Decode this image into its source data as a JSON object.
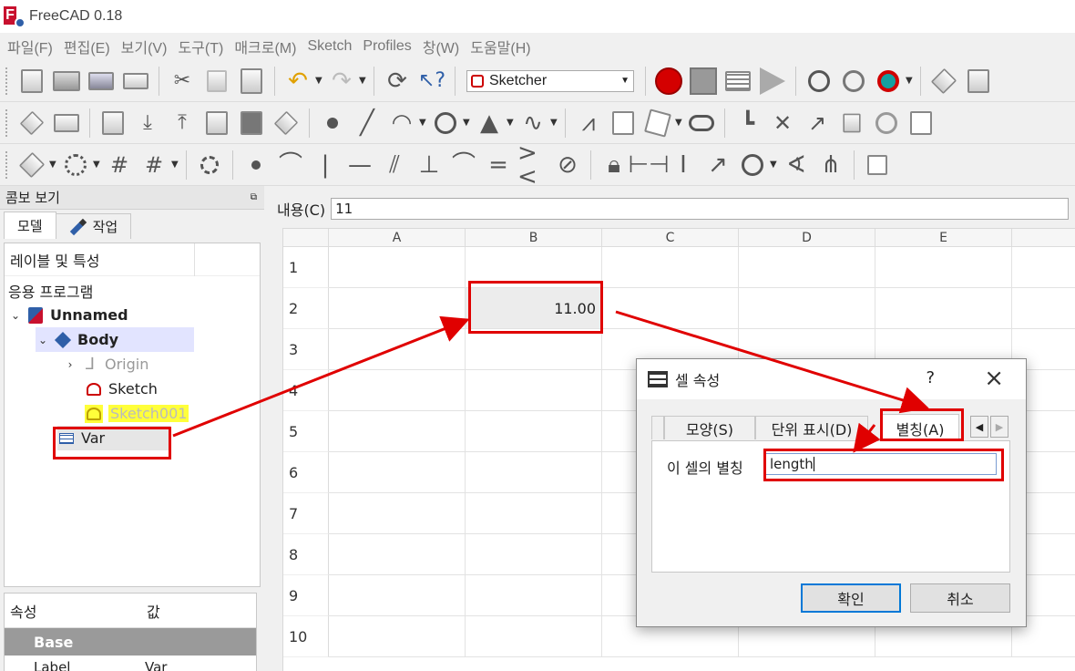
{
  "window": {
    "title": "FreeCAD 0.18"
  },
  "menu": [
    "파일(F)",
    "편집(E)",
    "보기(V)",
    "도구(T)",
    "매크로(M)",
    "Sketch",
    "Profiles",
    "창(W)",
    "도움말(H)"
  ],
  "toolbar": {
    "workbench": "Sketcher"
  },
  "combo": {
    "title": "콤보 보기",
    "tabs": {
      "model": "모델",
      "task": "작업"
    },
    "tree_header": "레이블 및 특성",
    "application": "응용 프로그램",
    "items": {
      "document": "Unnamed",
      "body": "Body",
      "origin": "Origin",
      "sketch": "Sketch",
      "sketch001": "Sketch001",
      "var": "Var"
    },
    "props": {
      "col_property": "속성",
      "col_value": "값",
      "group": "Base",
      "label_key": "Label",
      "label_value": "Var"
    }
  },
  "content": {
    "label": "내용(C)",
    "value": "11"
  },
  "sheet": {
    "columns": [
      "A",
      "B",
      "C",
      "D",
      "E"
    ],
    "rows": [
      "1",
      "2",
      "3",
      "4",
      "5",
      "6",
      "7",
      "8",
      "9",
      "10"
    ],
    "b2": "11.00"
  },
  "dialog": {
    "title": "셀 속성",
    "help": "?",
    "tabs": {
      "style": "모양(S)",
      "units": "단위 표시(D)",
      "alias": "별칭(A)"
    },
    "alias_label": "이 셀의 별칭",
    "alias_value": "length",
    "ok": "확인",
    "cancel": "취소"
  },
  "colors": {
    "annotation": "#e00000",
    "selection_body": "#e2e4ff",
    "highlight_sketch": "#ffff3a"
  }
}
